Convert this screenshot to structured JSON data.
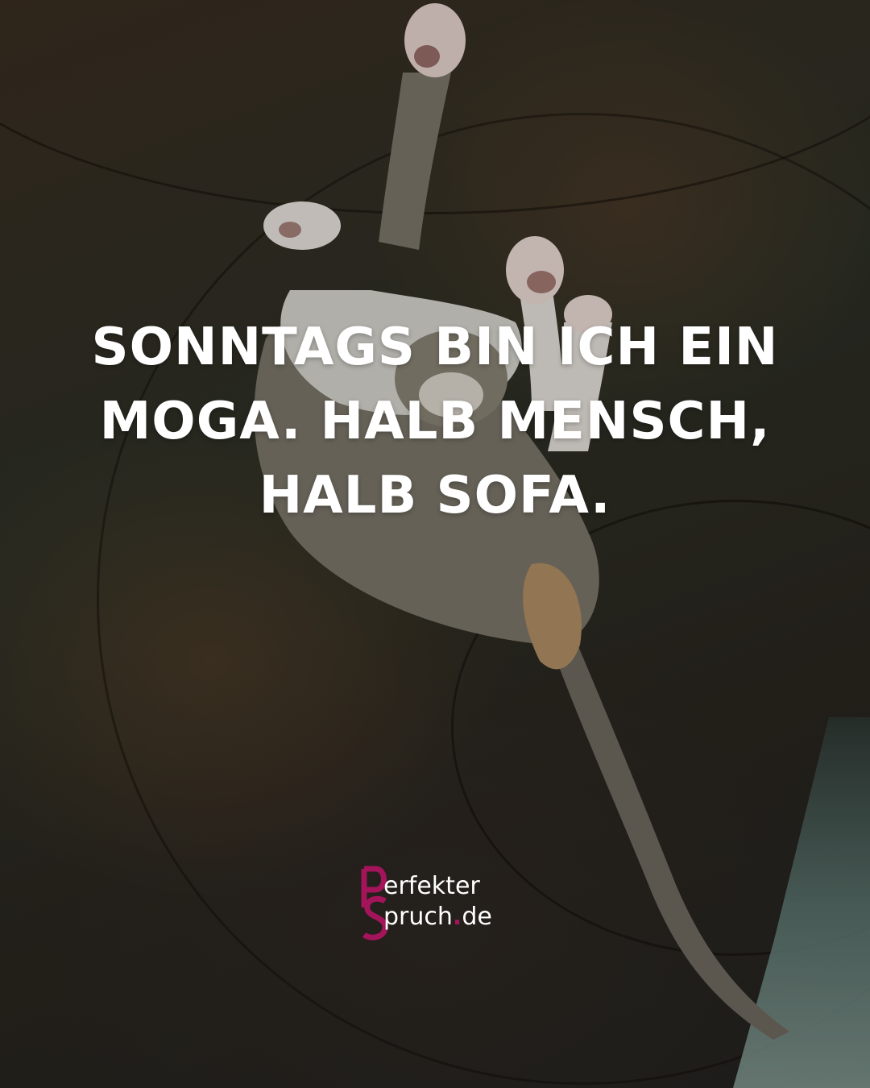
{
  "quote": {
    "line1": "SONNTAGS BIN ICH EIN",
    "line2": "MOGA. HALB MENSCH,",
    "line3": "HALB SOFA."
  },
  "logo": {
    "line1": "erfekter",
    "line2_a": "pruch",
    "dot": ".",
    "line2_b": "de",
    "brand_color": "#a4145a"
  },
  "colors": {
    "text": "#ffffff"
  }
}
